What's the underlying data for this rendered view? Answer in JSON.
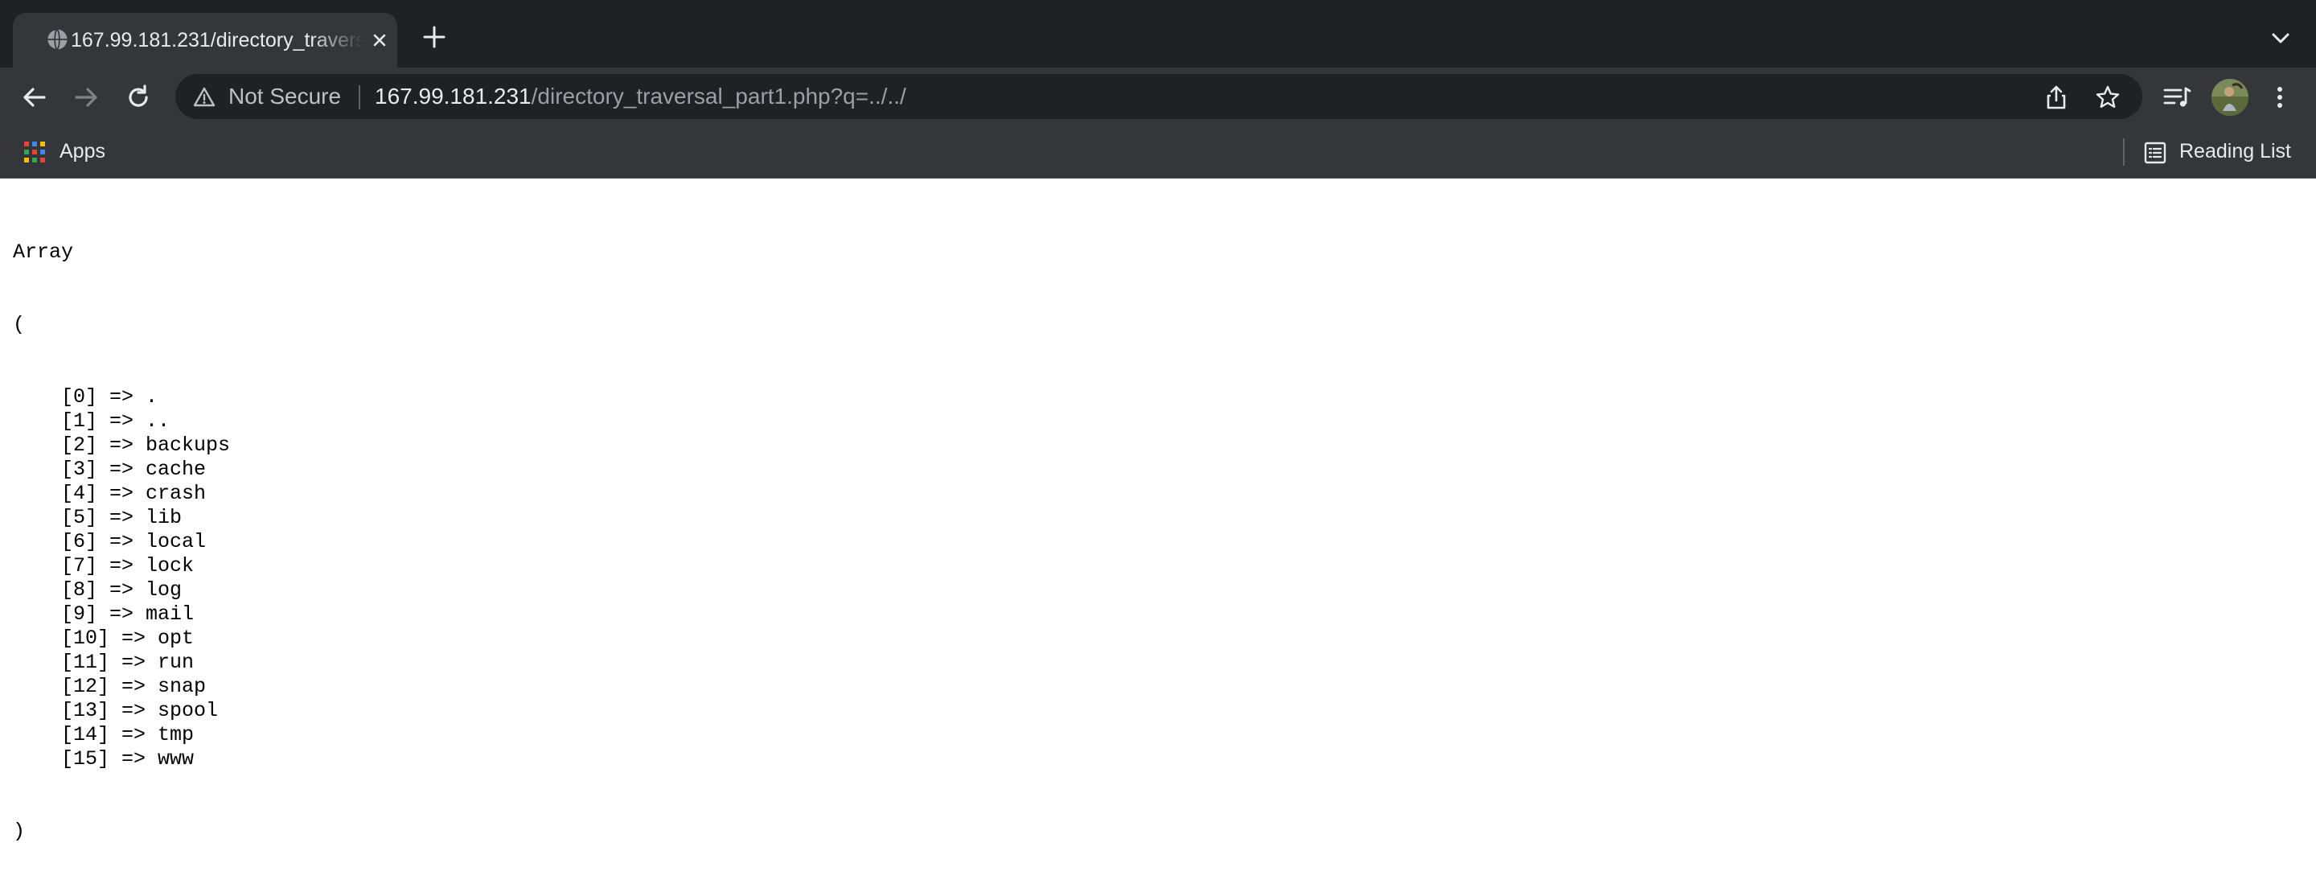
{
  "tab": {
    "title": "167.99.181.231/directory_traversal_part1.php?q=../../",
    "favicon_icon": "globe-icon",
    "close_icon": "close-icon"
  },
  "tabstrip": {
    "new_tab_icon": "plus-icon",
    "tab_search_icon": "chevron-down-icon"
  },
  "toolbar": {
    "back_icon": "back-arrow-icon",
    "forward_icon": "forward-arrow-icon",
    "reload_icon": "reload-icon",
    "security_label": "Not Secure",
    "url_host": "167.99.181.231",
    "url_path": "/directory_traversal_part1.php?q=../../",
    "share_icon": "share-icon",
    "bookmark_icon": "star-icon",
    "media_icon": "media-queue-icon",
    "menu_icon": "kebab-menu-icon"
  },
  "bookmarks": {
    "apps_label": "Apps",
    "reading_list_label": "Reading List"
  },
  "page": {
    "header": "Array",
    "open": "(",
    "close": ")",
    "entries": [
      {
        "index": "[0] => ",
        "value": "."
      },
      {
        "index": "[1] => ",
        "value": ".."
      },
      {
        "index": "[2] => ",
        "value": "backups"
      },
      {
        "index": "[3] => ",
        "value": "cache"
      },
      {
        "index": "[4] => ",
        "value": "crash"
      },
      {
        "index": "[5] => ",
        "value": "lib"
      },
      {
        "index": "[6] => ",
        "value": "local"
      },
      {
        "index": "[7] => ",
        "value": "lock"
      },
      {
        "index": "[8] => ",
        "value": "log"
      },
      {
        "index": "[9] => ",
        "value": "mail"
      },
      {
        "index": "[10] => ",
        "value": "opt"
      },
      {
        "index": "[11] => ",
        "value": "run"
      },
      {
        "index": "[12] => ",
        "value": "snap"
      },
      {
        "index": "[13] => ",
        "value": "spool"
      },
      {
        "index": "[14] => ",
        "value": "tmp"
      },
      {
        "index": "[15] => ",
        "value": "www"
      }
    ]
  },
  "colors": {
    "tabstrip_bg": "#202124",
    "toolbar_bg": "#35363a",
    "text_primary": "#e8eaed",
    "text_secondary": "#9aa0a6"
  }
}
